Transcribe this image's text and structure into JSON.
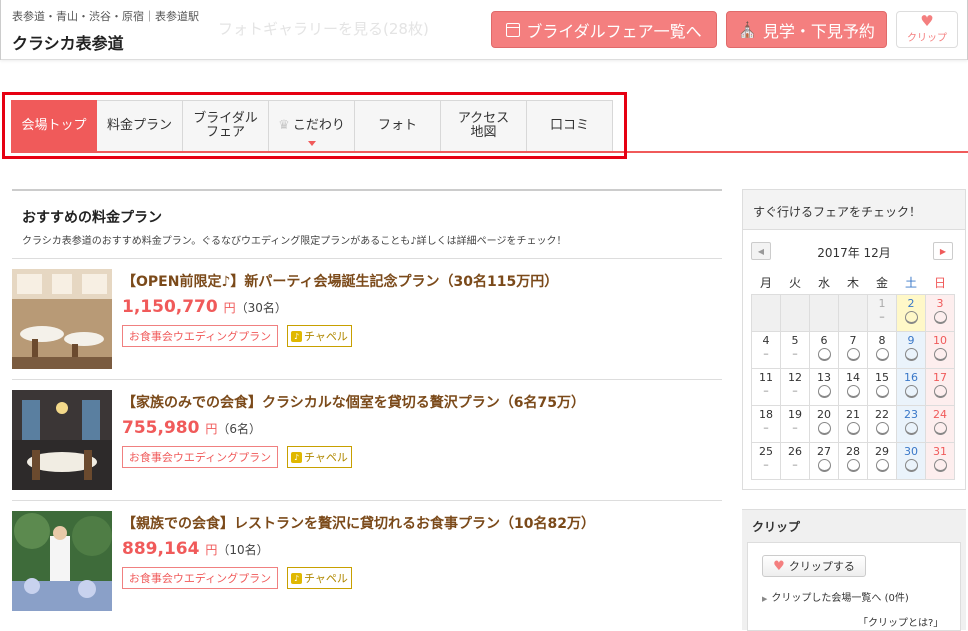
{
  "header": {
    "area": "表参道・青山・渋谷・原宿｜表参道駅",
    "venue_name": "クラシカ表参道",
    "ghost_text": "フォトギャラリーを見る(28枚)",
    "fair_button": "ブライダルフェア一覧へ",
    "visit_button": "見学・下見予約",
    "clip_button": "クリップ"
  },
  "tabs": [
    {
      "label": "会場トップ"
    },
    {
      "label": "料金プラン"
    },
    {
      "label_line1": "ブライダル",
      "label_line2": "フェア"
    },
    {
      "label": "こだわり"
    },
    {
      "label": "フォト"
    },
    {
      "label_line1": "アクセス",
      "label_line2": "地図"
    },
    {
      "label": "口コミ"
    }
  ],
  "plans_section": {
    "title": "おすすめの料金プラン",
    "desc": "クラシカ表参道のおすすめ料金プラン。ぐるなびウエディング限定プランがあることも♪詳しくは詳細ページをチェック！",
    "plans": [
      {
        "name": "【OPEN前限定♪】新パーティ会場誕生記念プラン（30名115万円）",
        "price": "1,150,770",
        "yen": "円",
        "people": "（30名）",
        "tag1": "お食事会ウエディングプラン",
        "tag2": "チャペル"
      },
      {
        "name": "【家族のみでの会食】クラシカルな個室を貸切る贅沢プラン（6名75万）",
        "price": "755,980",
        "yen": "円",
        "people": "（6名）",
        "tag1": "お食事会ウエディングプラン",
        "tag2": "チャペル"
      },
      {
        "name": "【親族での会食】レストランを贅沢に貸切れるお食事プラン（10名82万）",
        "price": "889,164",
        "yen": "円",
        "people": "（10名）",
        "tag1": "お食事会ウエディングプラン",
        "tag2": "チャペル"
      }
    ]
  },
  "calendar": {
    "title": "すぐ行けるフェアをチェック！",
    "month": "2017年 12月",
    "weekdays": [
      "月",
      "火",
      "水",
      "木",
      "金",
      "土",
      "日"
    ],
    "weeks": [
      [
        {
          "d": "",
          "m": ""
        },
        {
          "d": "",
          "m": ""
        },
        {
          "d": "",
          "m": ""
        },
        {
          "d": "",
          "m": ""
        },
        {
          "d": "1",
          "m": "–"
        },
        {
          "d": "2",
          "m": "o"
        },
        {
          "d": "3",
          "m": "o"
        }
      ],
      [
        {
          "d": "4",
          "m": "–"
        },
        {
          "d": "5",
          "m": "–"
        },
        {
          "d": "6",
          "m": "o"
        },
        {
          "d": "7",
          "m": "o"
        },
        {
          "d": "8",
          "m": "o"
        },
        {
          "d": "9",
          "m": "o"
        },
        {
          "d": "10",
          "m": "o"
        }
      ],
      [
        {
          "d": "11",
          "m": "–"
        },
        {
          "d": "12",
          "m": "–"
        },
        {
          "d": "13",
          "m": "o"
        },
        {
          "d": "14",
          "m": "o"
        },
        {
          "d": "15",
          "m": "o"
        },
        {
          "d": "16",
          "m": "o"
        },
        {
          "d": "17",
          "m": "o"
        }
      ],
      [
        {
          "d": "18",
          "m": "–"
        },
        {
          "d": "19",
          "m": "–"
        },
        {
          "d": "20",
          "m": "o"
        },
        {
          "d": "21",
          "m": "o"
        },
        {
          "d": "22",
          "m": "o"
        },
        {
          "d": "23",
          "m": "o"
        },
        {
          "d": "24",
          "m": "o"
        }
      ],
      [
        {
          "d": "25",
          "m": "–"
        },
        {
          "d": "26",
          "m": "–"
        },
        {
          "d": "27",
          "m": "o"
        },
        {
          "d": "28",
          "m": "o"
        },
        {
          "d": "29",
          "m": "o"
        },
        {
          "d": "30",
          "m": "o"
        },
        {
          "d": "31",
          "m": "o"
        }
      ]
    ]
  },
  "clip": {
    "title": "クリップ",
    "button": "クリップする",
    "list_link": "クリップした会場一覧へ (0件)",
    "what": "「クリップとは?」"
  },
  "icons": {
    "fair": "calendar-icon",
    "visit": "church-icon",
    "clip": "heart-icon",
    "kodawari": "crown-icon",
    "chapel": "bell-icon"
  }
}
